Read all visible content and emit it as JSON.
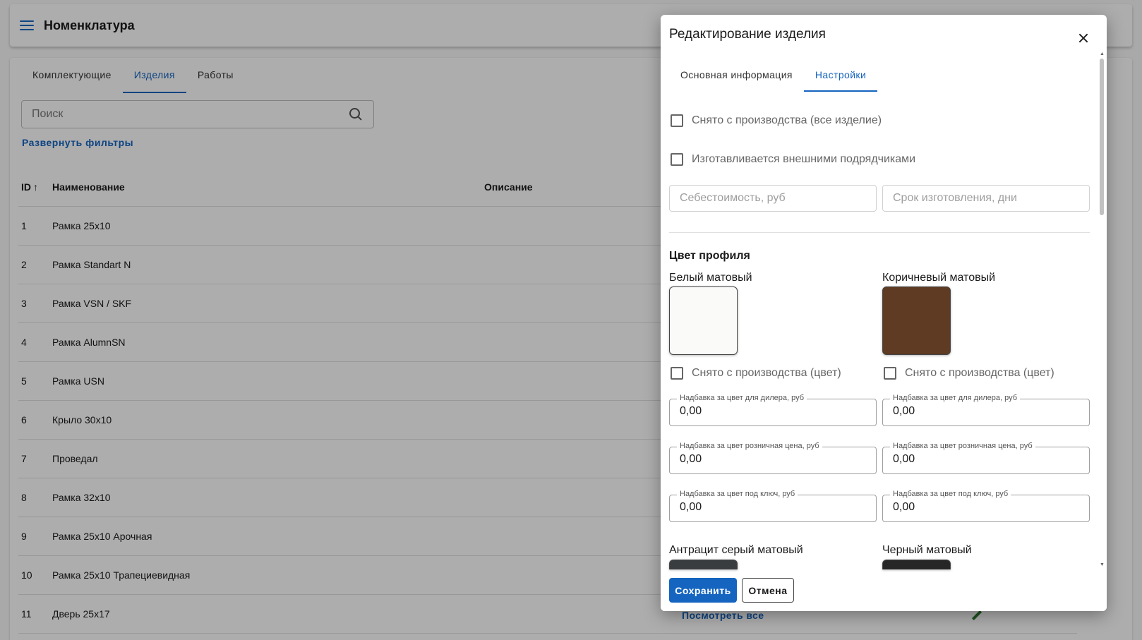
{
  "app": {
    "title": "Номенклатура"
  },
  "tabs": [
    {
      "label": "Комплектующие"
    },
    {
      "label": "Изделия",
      "active": true
    },
    {
      "label": "Работы"
    }
  ],
  "search": {
    "placeholder": "Поиск",
    "value": ""
  },
  "filters_link": "Развернуть фильтры",
  "table": {
    "columns": {
      "id": "ID",
      "name": "Наименование",
      "description": "Описание"
    },
    "sort_indicator": "↑",
    "rows": [
      {
        "id": "1",
        "name": "Рамка 25x10",
        "description": ""
      },
      {
        "id": "2",
        "name": "Рамка Standart N",
        "description": ""
      },
      {
        "id": "3",
        "name": "Рамка VSN / SKF",
        "description": ""
      },
      {
        "id": "4",
        "name": "Рамка AlumnSN",
        "description": ""
      },
      {
        "id": "5",
        "name": "Рамка USN",
        "description": ""
      },
      {
        "id": "6",
        "name": "Крыло 30x10",
        "description": ""
      },
      {
        "id": "7",
        "name": "Проведал",
        "description": ""
      },
      {
        "id": "8",
        "name": "Рамка 32x10",
        "description": ""
      },
      {
        "id": "9",
        "name": "Рамка 25x10 Арочная",
        "description": ""
      },
      {
        "id": "10",
        "name": "Рамка 25x10 Трапециевидная",
        "description": ""
      },
      {
        "id": "11",
        "name": "Дверь 25x17",
        "description": ""
      }
    ],
    "see_all": "Посмотреть все"
  },
  "dialog": {
    "title": "Редактирование изделия",
    "tabs": [
      {
        "label": "Основная информация"
      },
      {
        "label": "Настройки",
        "active": true
      }
    ],
    "discontinued_all": "Снято с производства (все изделие)",
    "external_contractors": "Изготавливается внешними подрядчиками",
    "cost_placeholder": "Себестоимость, руб",
    "lead_time_placeholder": "Срок изготовления, дни",
    "profile_color_title": "Цвет профиля",
    "colors": [
      {
        "name": "Белый матовый",
        "swatch": "#fafaf8",
        "discontinued_label": "Снято с производства (цвет)",
        "dealer_label": "Надбавка за цвет для дилера, руб",
        "dealer_value": "0,00",
        "retail_label": "Надбавка за цвет розничная цена, руб",
        "retail_value": "0,00",
        "turnkey_label": "Надбавка за цвет под ключ, руб",
        "turnkey_value": "0,00"
      },
      {
        "name": "Коричневый матовый",
        "swatch": "#5e3b22",
        "discontinued_label": "Снято с производства (цвет)",
        "dealer_label": "Надбавка за цвет для дилера, руб",
        "dealer_value": "0,00",
        "retail_label": "Надбавка за цвет розничная цена, руб",
        "retail_value": "0,00",
        "turnkey_label": "Надбавка за цвет под ключ, руб",
        "turnkey_value": "0,00"
      },
      {
        "name": "Антрацит серый матовый",
        "swatch": "#3a3d40"
      },
      {
        "name": "Черный матовый",
        "swatch": "#262626"
      }
    ],
    "save_label": "Сохранить",
    "cancel_label": "Отмена"
  },
  "theme": {
    "accent": "#1565c0",
    "scrim": "rgba(0,0,0,0.32)"
  }
}
